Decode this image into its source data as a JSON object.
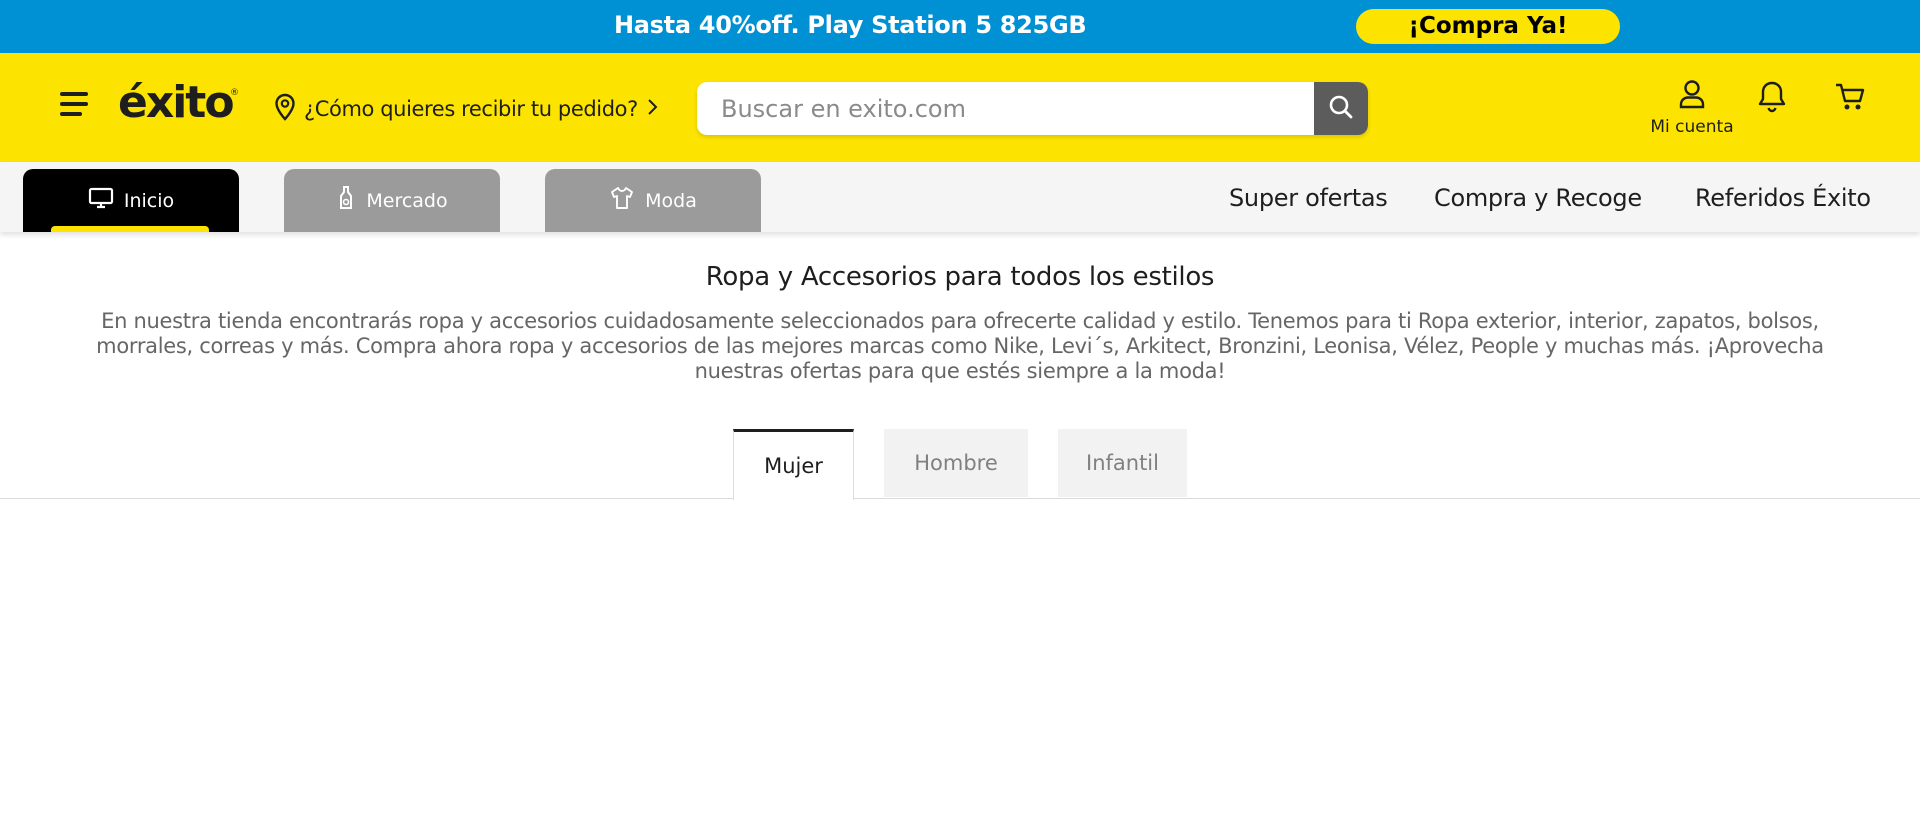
{
  "promo": {
    "text": "Hasta 40%off. Play Station 5 825GB",
    "button_label": "¡Compra Ya!"
  },
  "header": {
    "logo": "éxito",
    "logo_mark": "®",
    "location_prompt": "¿Cómo quieres recibir tu pedido?",
    "search_placeholder": "Buscar en exito.com",
    "account_label": "Mi cuenta",
    "icons": [
      "menu-icon",
      "location-pin-icon",
      "chevron-right-icon",
      "search-icon",
      "user-icon",
      "bell-icon",
      "cart-icon"
    ]
  },
  "nav": {
    "tabs": [
      {
        "label": "Inicio",
        "icon": "monitor-icon",
        "active": true
      },
      {
        "label": "Mercado",
        "icon": "bottle-icon",
        "active": false
      },
      {
        "label": "Moda",
        "icon": "shirt-icon",
        "active": false
      }
    ],
    "links": [
      "Super ofertas",
      "Compra y Recoge",
      "Referidos Éxito"
    ]
  },
  "content": {
    "title": "Ropa y Accesorios para todos los estilos",
    "description": "En nuestra tienda encontrarás ropa y accesorios cuidadosamente seleccionados para ofrecerte calidad y estilo. Tenemos para ti Ropa exterior, interior, zapatos, bolsos, morrales, correas y más. Compra ahora ropa y accesorios de las mejores marcas como Nike, Levi´s, Arkitect, Bronzini, Leonisa, Vélez, People y muchas más. ¡Aprovecha nuestras ofertas para que estés siempre a la moda!",
    "tabs": [
      {
        "label": "Mujer",
        "active": true
      },
      {
        "label": "Hombre",
        "active": false
      },
      {
        "label": "Infantil",
        "active": false
      }
    ]
  },
  "colors": {
    "promo_blue": "#0091d4",
    "brand_yellow": "#fde400",
    "logo_red": "#e6202a",
    "nav_active": "#000000",
    "nav_inactive": "#9b9b9b"
  }
}
